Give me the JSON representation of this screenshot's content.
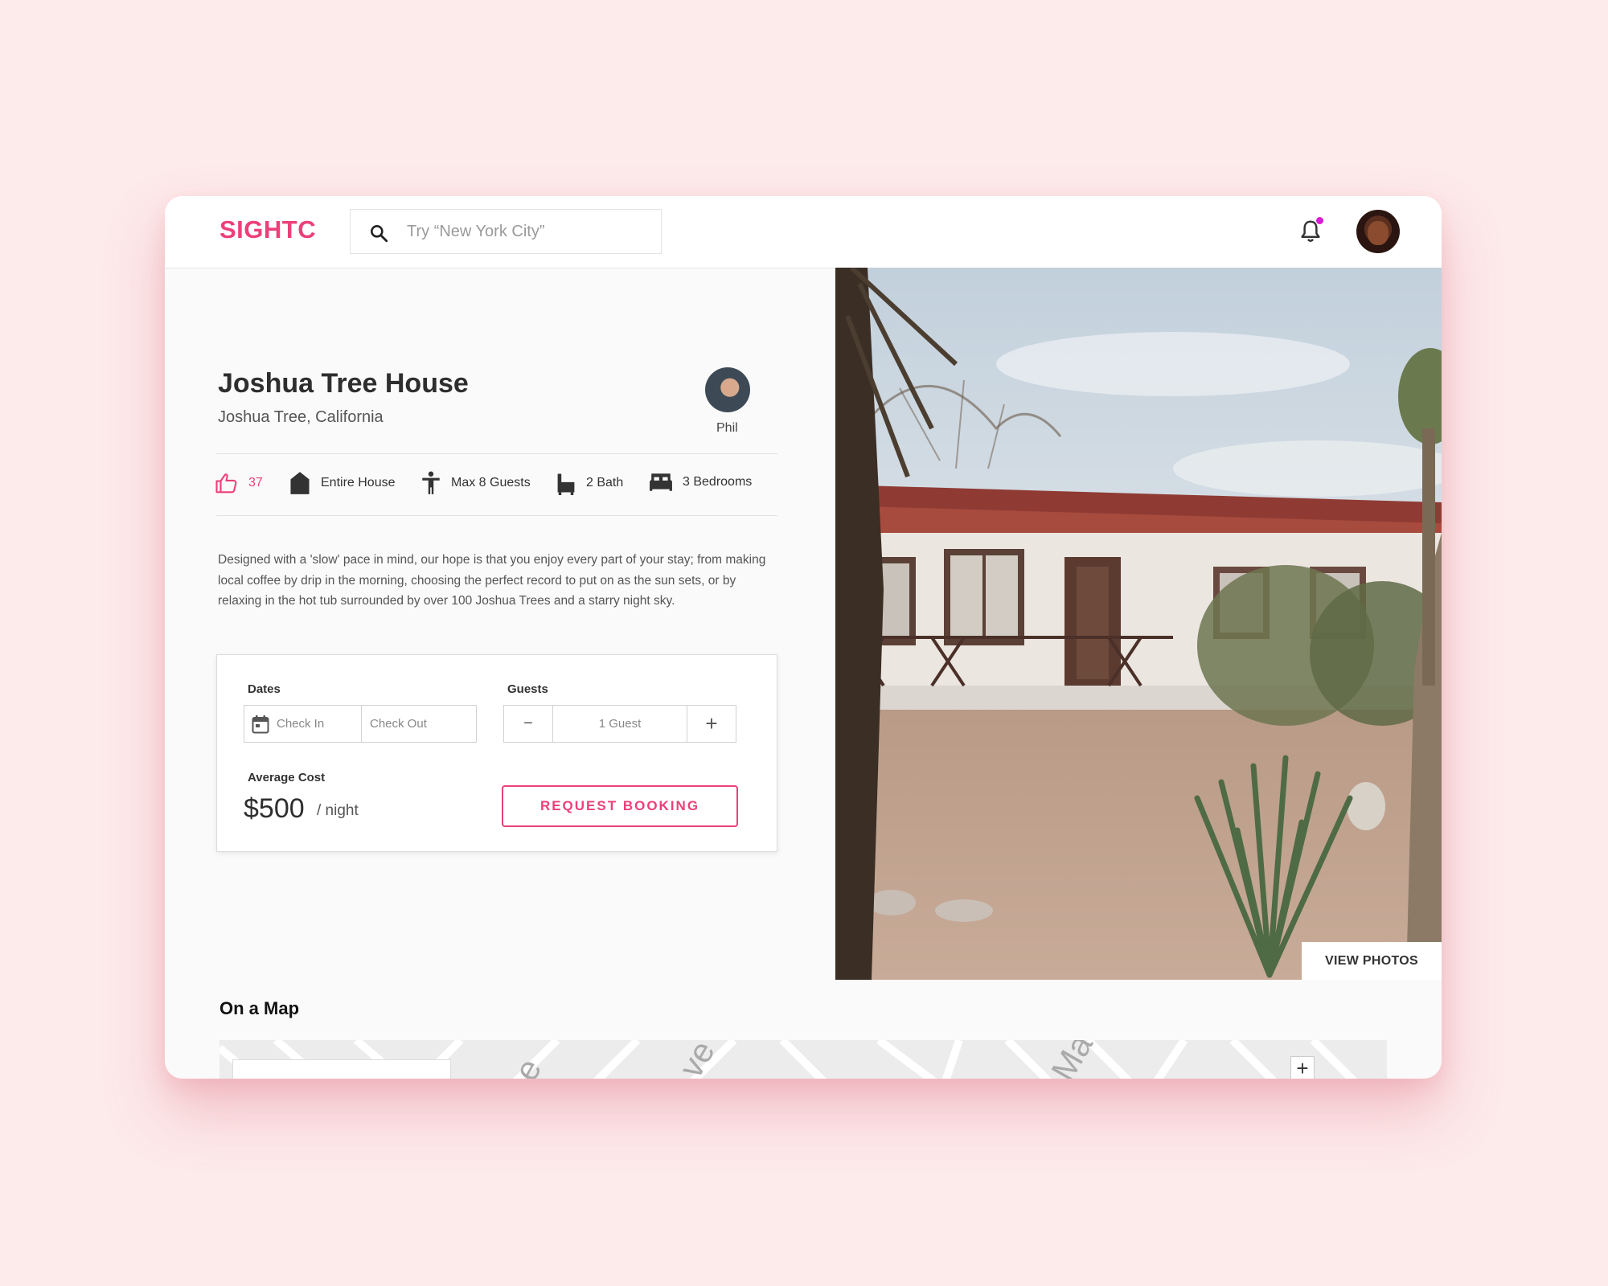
{
  "app": {
    "logo": "SIGHTC"
  },
  "search": {
    "placeholder": "Try “New York City”"
  },
  "listing": {
    "title": "Joshua Tree House",
    "location": "Joshua Tree, California",
    "host_name": "Phil",
    "likes": "37",
    "features": {
      "type": "Entire House",
      "guests": "Max 8 Guests",
      "bath": "2 Bath",
      "bedrooms": "3 Bedrooms"
    },
    "description": "Designed with a 'slow' pace in mind, our hope is that you enjoy every part of your stay; from making local coffee by drip in the morning, choosing the perfect record to put on as the sun sets, or by relaxing in the hot tub surrounded by over 100 Joshua Trees and a starry night sky."
  },
  "booking": {
    "dates_label": "Dates",
    "check_in_placeholder": "Check In",
    "check_out_placeholder": "Check Out",
    "guests_label": "Guests",
    "guest_minus": "−",
    "guest_count": "1 Guest",
    "guest_plus": "+",
    "avg_cost_label": "Average Cost",
    "price": "$500",
    "price_unit": "/ night",
    "request_button": "REQUEST BOOKING"
  },
  "photo": {
    "view_button": "VIEW PHOTOS"
  },
  "map": {
    "title": "On a Map",
    "zoom_in": "+",
    "street_labels": [
      "e",
      "ve",
      "Ma"
    ]
  },
  "colors": {
    "accent": "#ec407a",
    "notification_dot": "#d81bd8",
    "page_bg": "#fdeaea"
  }
}
